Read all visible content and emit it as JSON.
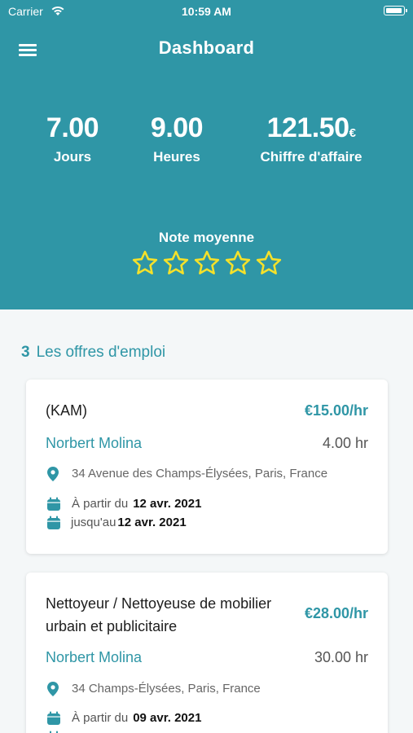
{
  "status_bar": {
    "carrier": "Carrier",
    "time": "10:59 AM"
  },
  "header": {
    "title": "Dashboard"
  },
  "stats": [
    {
      "value": "7.00",
      "label": "Jours"
    },
    {
      "value": "9.00",
      "label": "Heures"
    },
    {
      "value": "121.50",
      "unit": "€",
      "label": "Chiffre d'affaire"
    }
  ],
  "rating": {
    "label": "Note moyenne",
    "stars_filled": 0,
    "stars_total": 5,
    "star_color": "#f5e12a"
  },
  "offers": {
    "count": "3",
    "title": "Les offres d'emploi",
    "items": [
      {
        "title": "(KAM)",
        "rate": "€15.00/hr",
        "person": "Norbert Molina",
        "hours": "4.00 hr",
        "address": "34 Avenue des Champs-Élysées, Paris, France",
        "from_label": "À partir du",
        "from_date": "12 avr. 2021",
        "until_label": "jusqu'au",
        "until_date": "12 avr. 2021"
      },
      {
        "title_line1": "Nettoyeur / Nettoyeuse de mobilier",
        "title_line2": "urbain et publicitaire",
        "rate": "€28.00/hr",
        "person": "Norbert Molina",
        "hours": "30.00 hr",
        "address": "34 Champs-Élysées, Paris, France",
        "from_label": "À partir du",
        "from_date": "09 avr. 2021"
      }
    ]
  },
  "colors": {
    "accent": "#2f96a6",
    "background": "#f4f7f8"
  }
}
